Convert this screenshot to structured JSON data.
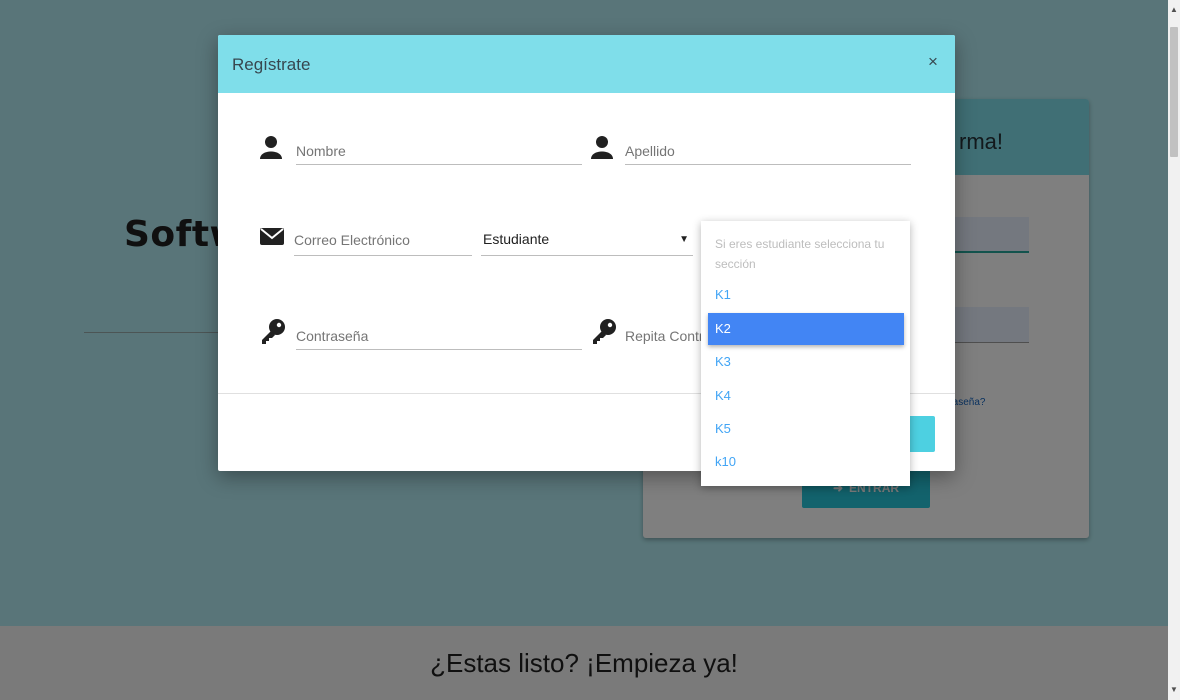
{
  "background_page": {
    "hero_title": "Softw",
    "login_card": {
      "header_text": "rma!",
      "forgot_link": "ntraseña?",
      "enter_button": "ENTRAR"
    },
    "footer_text": "¿Estas listo? ¡Empieza ya!"
  },
  "modal": {
    "title": "Regístrate",
    "close_label": "×",
    "fields": {
      "first_name": {
        "placeholder": "Nombre",
        "icon": "person-icon"
      },
      "last_name": {
        "placeholder": "Apellido",
        "icon": "person-icon"
      },
      "email": {
        "placeholder": "Correo Electrónico",
        "icon": "envelope-icon"
      },
      "role": {
        "value": "Estudiante",
        "caret": "▼"
      },
      "password": {
        "placeholder": "Contraseña",
        "icon": "key-icon"
      },
      "repeat_password": {
        "placeholder": "Repita Contr",
        "icon": "key-icon"
      }
    }
  },
  "section_dropdown": {
    "hint": "Si eres estudiante selecciona tu sección",
    "options": [
      "K1",
      "K2",
      "K3",
      "K4",
      "K5",
      "k10"
    ],
    "selected": "K2"
  },
  "colors": {
    "modal_header": "#7fdeea",
    "selected_option": "#4285f4",
    "option_text": "#42a5f5"
  }
}
